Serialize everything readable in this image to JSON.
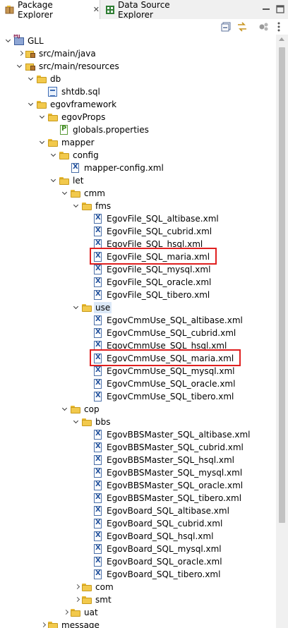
{
  "tabs": [
    {
      "label": "Package Explorer",
      "icon": "package-explorer-icon",
      "active": true
    },
    {
      "label": "Data Source Explorer",
      "icon": "data-source-explorer-icon",
      "active": false
    }
  ],
  "tree": [
    {
      "label": "GLL",
      "depth": 0,
      "icon": "project",
      "toggle": "open"
    },
    {
      "label": "src/main/java",
      "depth": 1,
      "icon": "src-folder",
      "toggle": "closed"
    },
    {
      "label": "src/main/resources",
      "depth": 1,
      "icon": "src-folder",
      "toggle": "open"
    },
    {
      "label": "db",
      "depth": 2,
      "icon": "folder",
      "toggle": "open"
    },
    {
      "label": "shtdb.sql",
      "depth": 3,
      "icon": "sql-file",
      "toggle": "none"
    },
    {
      "label": "egovframework",
      "depth": 2,
      "icon": "folder",
      "toggle": "open"
    },
    {
      "label": "egovProps",
      "depth": 3,
      "icon": "folder",
      "toggle": "open"
    },
    {
      "label": "globals.properties",
      "depth": 4,
      "icon": "properties-file",
      "toggle": "none"
    },
    {
      "label": "mapper",
      "depth": 3,
      "icon": "folder",
      "toggle": "open"
    },
    {
      "label": "config",
      "depth": 4,
      "icon": "folder",
      "toggle": "open"
    },
    {
      "label": "mapper-config.xml",
      "depth": 5,
      "icon": "xml-file",
      "toggle": "none"
    },
    {
      "label": "let",
      "depth": 4,
      "icon": "folder",
      "toggle": "open"
    },
    {
      "label": "cmm",
      "depth": 5,
      "icon": "folder",
      "toggle": "open"
    },
    {
      "label": "fms",
      "depth": 6,
      "icon": "folder",
      "toggle": "open"
    },
    {
      "label": "EgovFile_SQL_altibase.xml",
      "depth": 7,
      "icon": "xml-file",
      "toggle": "none"
    },
    {
      "label": "EgovFile_SQL_cubrid.xml",
      "depth": 7,
      "icon": "xml-file",
      "toggle": "none"
    },
    {
      "label": "EgovFile_SQL_hsql.xml",
      "depth": 7,
      "icon": "xml-file",
      "toggle": "none"
    },
    {
      "label": "EgovFile_SQL_maria.xml",
      "depth": 7,
      "icon": "xml-file",
      "toggle": "none",
      "boxed": true
    },
    {
      "label": "EgovFile_SQL_mysql.xml",
      "depth": 7,
      "icon": "xml-file",
      "toggle": "none"
    },
    {
      "label": "EgovFile_SQL_oracle.xml",
      "depth": 7,
      "icon": "xml-file",
      "toggle": "none"
    },
    {
      "label": "EgovFile_SQL_tibero.xml",
      "depth": 7,
      "icon": "xml-file",
      "toggle": "none"
    },
    {
      "label": "use",
      "depth": 6,
      "icon": "folder",
      "toggle": "open",
      "selected": true
    },
    {
      "label": "EgovCmmUse_SQL_altibase.xml",
      "depth": 7,
      "icon": "xml-file",
      "toggle": "none"
    },
    {
      "label": "EgovCmmUse_SQL_cubrid.xml",
      "depth": 7,
      "icon": "xml-file",
      "toggle": "none"
    },
    {
      "label": "EgovCmmUse_SQL_hsql.xml",
      "depth": 7,
      "icon": "xml-file",
      "toggle": "none"
    },
    {
      "label": "EgovCmmUse_SQL_maria.xml",
      "depth": 7,
      "icon": "xml-file",
      "toggle": "none",
      "boxed": true
    },
    {
      "label": "EgovCmmUse_SQL_mysql.xml",
      "depth": 7,
      "icon": "xml-file",
      "toggle": "none"
    },
    {
      "label": "EgovCmmUse_SQL_oracle.xml",
      "depth": 7,
      "icon": "xml-file",
      "toggle": "none"
    },
    {
      "label": "EgovCmmUse_SQL_tibero.xml",
      "depth": 7,
      "icon": "xml-file",
      "toggle": "none"
    },
    {
      "label": "cop",
      "depth": 5,
      "icon": "folder",
      "toggle": "open"
    },
    {
      "label": "bbs",
      "depth": 6,
      "icon": "folder",
      "toggle": "open"
    },
    {
      "label": "EgovBBSMaster_SQL_altibase.xml",
      "depth": 7,
      "icon": "xml-file",
      "toggle": "none"
    },
    {
      "label": "EgovBBSMaster_SQL_cubrid.xml",
      "depth": 7,
      "icon": "xml-file",
      "toggle": "none"
    },
    {
      "label": "EgovBBSMaster_SQL_hsql.xml",
      "depth": 7,
      "icon": "xml-file",
      "toggle": "none"
    },
    {
      "label": "EgovBBSMaster_SQL_mysql.xml",
      "depth": 7,
      "icon": "xml-file",
      "toggle": "none"
    },
    {
      "label": "EgovBBSMaster_SQL_oracle.xml",
      "depth": 7,
      "icon": "xml-file",
      "toggle": "none"
    },
    {
      "label": "EgovBBSMaster_SQL_tibero.xml",
      "depth": 7,
      "icon": "xml-file",
      "toggle": "none"
    },
    {
      "label": "EgovBoard_SQL_altibase.xml",
      "depth": 7,
      "icon": "xml-file",
      "toggle": "none"
    },
    {
      "label": "EgovBoard_SQL_cubrid.xml",
      "depth": 7,
      "icon": "xml-file",
      "toggle": "none"
    },
    {
      "label": "EgovBoard_SQL_hsql.xml",
      "depth": 7,
      "icon": "xml-file",
      "toggle": "none"
    },
    {
      "label": "EgovBoard_SQL_mysql.xml",
      "depth": 7,
      "icon": "xml-file",
      "toggle": "none"
    },
    {
      "label": "EgovBoard_SQL_oracle.xml",
      "depth": 7,
      "icon": "xml-file",
      "toggle": "none"
    },
    {
      "label": "EgovBoard_SQL_tibero.xml",
      "depth": 7,
      "icon": "xml-file",
      "toggle": "none"
    },
    {
      "label": "com",
      "depth": 6,
      "icon": "folder",
      "toggle": "closed"
    },
    {
      "label": "smt",
      "depth": 6,
      "icon": "folder",
      "toggle": "closed"
    },
    {
      "label": "uat",
      "depth": 5,
      "icon": "folder",
      "toggle": "closed"
    },
    {
      "label": "message",
      "depth": 3,
      "icon": "folder",
      "toggle": "closed"
    }
  ],
  "colors": {
    "highlight_box": "#e02020",
    "selection": "#dbe8f7"
  }
}
